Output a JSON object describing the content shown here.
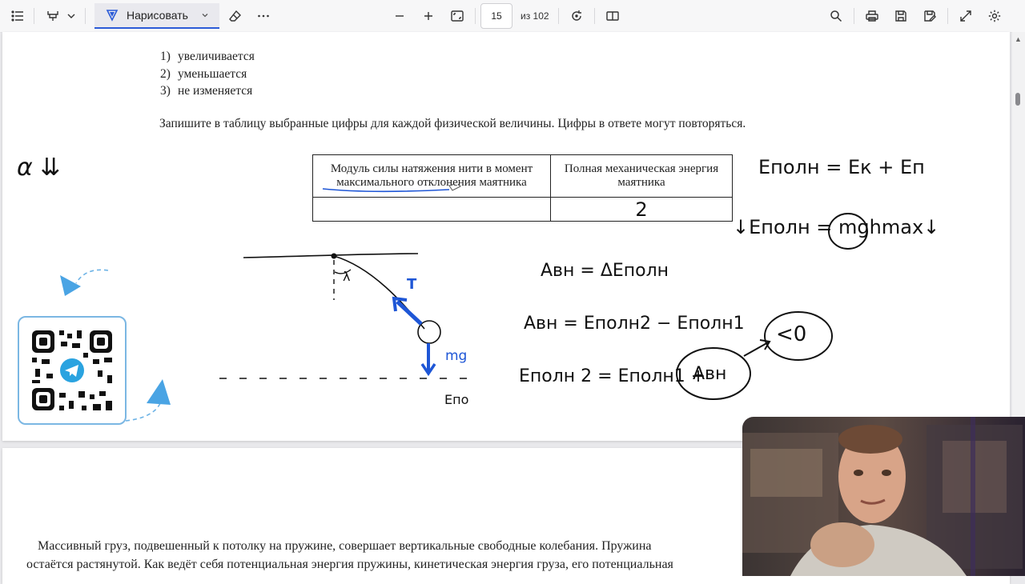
{
  "toolbar": {
    "draw_label": "Нарисовать",
    "page_current": "15",
    "page_total": "из 102",
    "icons": [
      "contents-icon",
      "highlight-icon",
      "chevron-down-icon",
      "draw-icon",
      "eraser-icon",
      "more-icon",
      "zoom-out-icon",
      "zoom-in-icon",
      "fit-page-icon",
      "rotate-icon",
      "two-page-icon",
      "search-icon",
      "print-icon",
      "save-icon",
      "save-as-icon",
      "fullscreen-icon",
      "settings-icon"
    ]
  },
  "page1": {
    "options": [
      {
        "num": "1)",
        "text": "увеличивается"
      },
      {
        "num": "2)",
        "text": "уменьшается"
      },
      {
        "num": "3)",
        "text": "не изменяется"
      }
    ],
    "instruction": "Запишите в таблицу выбранные цифры для каждой физической величины. Цифры в ответе могут повторяться.",
    "table": {
      "headers": [
        "Модуль силы натяжения нити в момент максимального отклонения маятника",
        "Полная механическая энергия маятника"
      ],
      "answers": [
        "",
        "2"
      ]
    },
    "handwriting": {
      "alpha": "α ⇊",
      "e_full": "Eполн = Eк + Eп",
      "e_full_min": "↓Eполн = mghmax↓",
      "a_eq1": "Aвн = ΔEполн",
      "a_eq2": "Aвн = Eполн2 − Eполн1",
      "a_eq3_left": "Eполн 2 = Eполн1 +",
      "a_bubble": "Aвн",
      "lt_zero": "<0",
      "diagram_T": "T",
      "diagram_mg": "mg",
      "diagram_alpha": "λ",
      "diagram_ep": "Eпо"
    }
  },
  "page2": {
    "line1": "Массивный груз, подвешенный к потолку на пружине, совершает вертикальные свободные колебания. Пружина",
    "line2": "остаётся растянутой. Как ведёт себя потенциальная энергия пружины, кинетическая энергия груза, его потенциальная"
  },
  "colors": {
    "accent": "#2b5bd7",
    "ink": "#111111",
    "pen_blue": "#1e56d6",
    "telegram": "#2aa3e0"
  }
}
